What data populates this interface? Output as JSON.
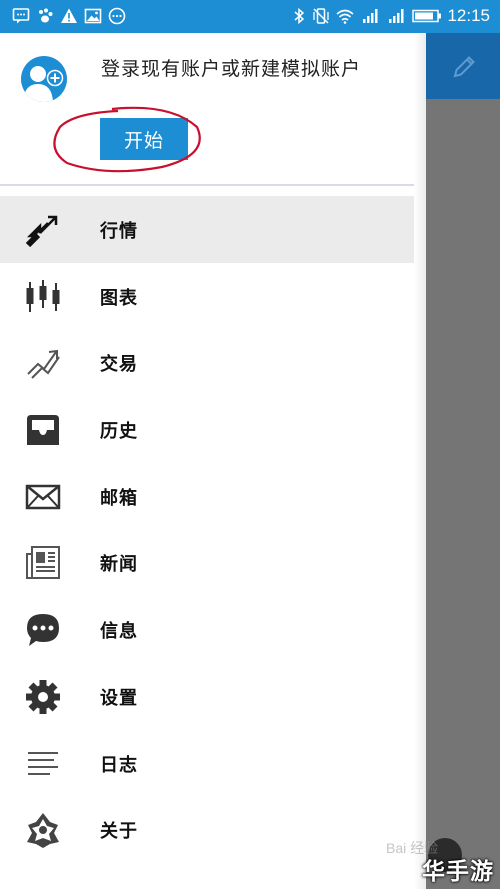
{
  "status_bar": {
    "time": "12:15",
    "left_icons": [
      "chat-bubble-icon",
      "paw-icon",
      "warning-icon",
      "image-icon",
      "more-circle-icon"
    ],
    "right_icons": [
      "bluetooth-icon",
      "vibrate-icon",
      "wifi-icon",
      "signal-icon",
      "signal-icon",
      "battery-icon"
    ]
  },
  "drawer": {
    "login_prompt": "登录现有账户或新建模拟账户",
    "start_label": "开始",
    "menu": [
      {
        "id": "quotes",
        "label": "行情",
        "icon": "arrows-diagonal-icon",
        "active": true
      },
      {
        "id": "chart",
        "label": "图表",
        "icon": "candlestick-icon",
        "active": false
      },
      {
        "id": "trade",
        "label": "交易",
        "icon": "trend-up-icon",
        "active": false
      },
      {
        "id": "history",
        "label": "历史",
        "icon": "inbox-tray-icon",
        "active": false
      },
      {
        "id": "mailbox",
        "label": "邮箱",
        "icon": "envelope-icon",
        "active": false
      },
      {
        "id": "news",
        "label": "新闻",
        "icon": "newspaper-icon",
        "active": false
      },
      {
        "id": "messages",
        "label": "信息",
        "icon": "chat-dots-icon",
        "active": false
      },
      {
        "id": "settings",
        "label": "设置",
        "icon": "gear-icon",
        "active": false
      },
      {
        "id": "journal",
        "label": "日志",
        "icon": "lines-icon",
        "active": false
      },
      {
        "id": "about",
        "label": "关于",
        "icon": "about-logo-icon",
        "active": false
      }
    ]
  },
  "background_app": {
    "edit_icon": "pencil-icon"
  },
  "overlay": {
    "watermark": "Bai 经验",
    "corner_brand": "华手游"
  },
  "colors": {
    "accent": "#1d8ed3",
    "toolbar_dark": "#1867a8",
    "annotation_red": "#c8102e",
    "active_row": "#ebebeb"
  }
}
